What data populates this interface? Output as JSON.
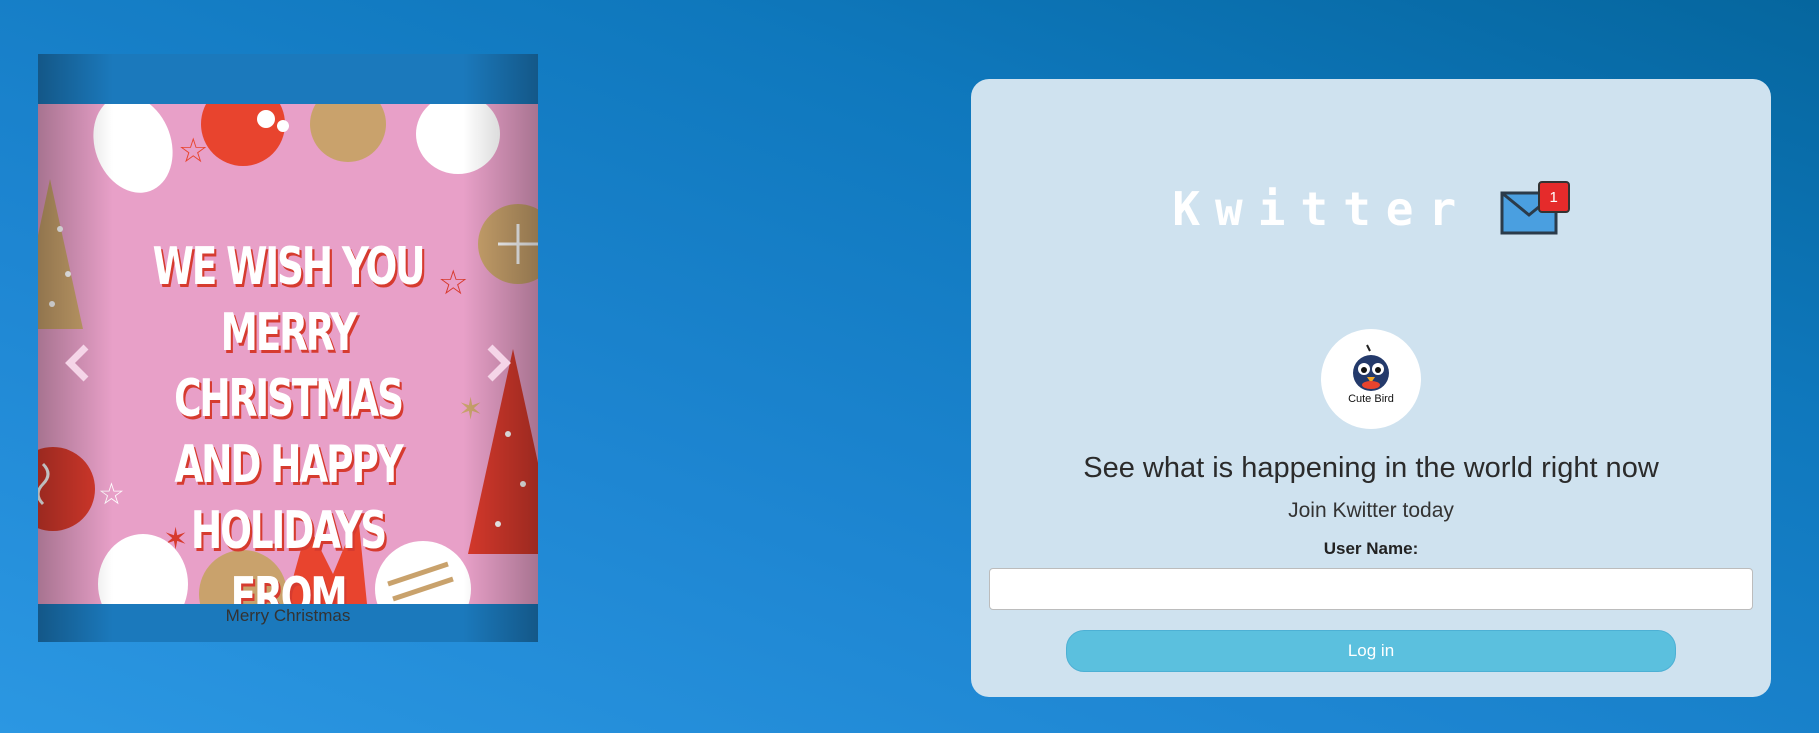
{
  "carousel": {
    "slide_text": "WE WISH YOU MERRY\nCHRISTMAS AND HAPPY\nHOLIDAYS FROM\nKWITTER",
    "caption": "Merry Christmas",
    "prev_icon": "chevron-left-icon",
    "next_icon": "chevron-right-icon",
    "slide_bg": "#e8a0c8"
  },
  "login": {
    "app_name": "Kwitter",
    "mail_badge": "1",
    "avatar_label": "Cute Bird",
    "headline": "See what is happening in the world right now",
    "subhead": "Join Kwitter today",
    "username_label": "User Name:",
    "username_value": "",
    "login_button": "Log in",
    "button_color": "#5bc0de"
  }
}
